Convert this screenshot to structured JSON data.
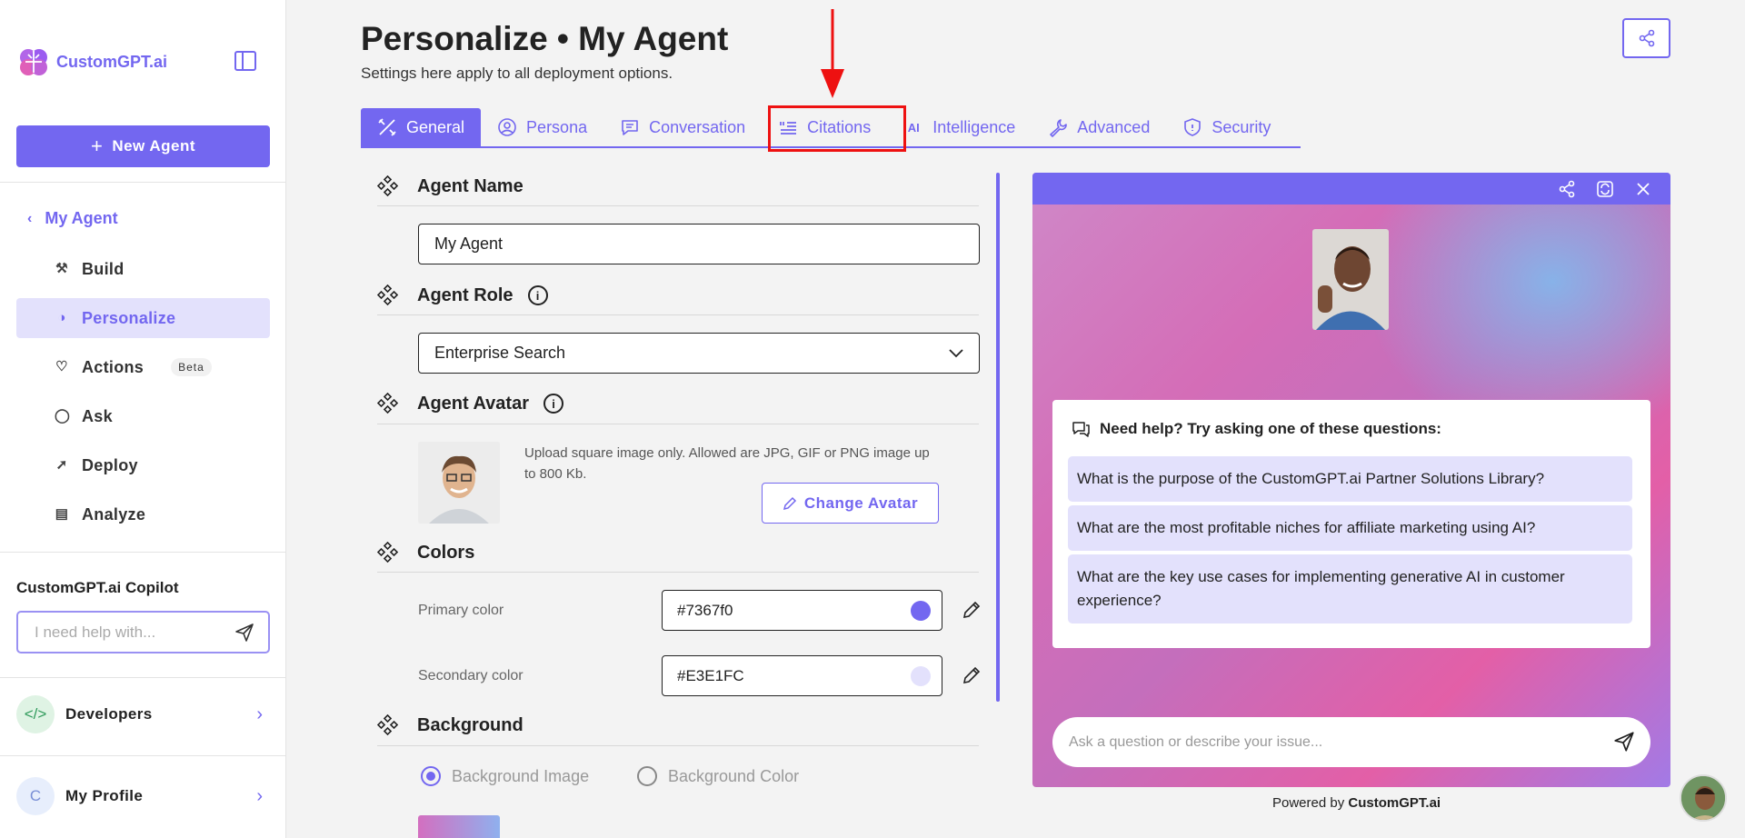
{
  "brand": {
    "name": "CustomGPT.ai",
    "accent": "#7367f0"
  },
  "sidebar": {
    "new_agent": "New Agent",
    "back": "My Agent",
    "items": [
      {
        "label": "Build",
        "icon": "hammer-icon"
      },
      {
        "label": "Personalize",
        "icon": "palette-icon",
        "active": true
      },
      {
        "label": "Actions",
        "icon": "heart-hand-icon",
        "badge": "Beta"
      },
      {
        "label": "Ask",
        "icon": "chat-icon"
      },
      {
        "label": "Deploy",
        "icon": "rocket-icon"
      },
      {
        "label": "Analyze",
        "icon": "bar-chart-icon"
      }
    ],
    "copilot_title": "CustomGPT.ai Copilot",
    "copilot_placeholder": "I need help with...",
    "developers": "Developers",
    "profile": "My Profile",
    "profile_initial": "C"
  },
  "header": {
    "title": "Personalize • My Agent",
    "subtitle": "Settings here apply to all deployment options."
  },
  "tabs": [
    {
      "label": "General",
      "icon": "tools-icon",
      "active": true
    },
    {
      "label": "Persona",
      "icon": "user-circle-icon"
    },
    {
      "label": "Conversation",
      "icon": "message-icon"
    },
    {
      "label": "Citations",
      "icon": "quote-list-icon"
    },
    {
      "label": "Intelligence",
      "icon": "ai-icon"
    },
    {
      "label": "Advanced",
      "icon": "wrench-icon"
    },
    {
      "label": "Security",
      "icon": "shield-icon"
    }
  ],
  "form": {
    "agent_name_label": "Agent Name",
    "agent_name_value": "My Agent",
    "agent_role_label": "Agent Role",
    "agent_role_value": "Enterprise Search",
    "agent_avatar_label": "Agent Avatar",
    "avatar_note": "Upload square image only. Allowed are JPG, GIF or PNG image up to 800 Kb.",
    "change_avatar": "Change Avatar",
    "colors_label": "Colors",
    "primary_label": "Primary color",
    "primary_value": "#7367f0",
    "secondary_label": "Secondary color",
    "secondary_value": "#E3E1FC",
    "background_label": "Background",
    "bg_image_option": "Background Image",
    "bg_color_option": "Background Color",
    "bg_selected": "Background Image"
  },
  "preview": {
    "help_title": "Need help? Try asking one of these questions:",
    "questions": [
      "What is the purpose of the CustomGPT.ai Partner Solutions Library?",
      "What are the most profitable niches for affiliate marketing using AI?",
      "What are the key use cases for implementing generative AI in customer experience?"
    ],
    "input_placeholder": "Ask a question or describe your issue...",
    "powered_prefix": "Powered by ",
    "powered_brand": "CustomGPT.ai"
  }
}
